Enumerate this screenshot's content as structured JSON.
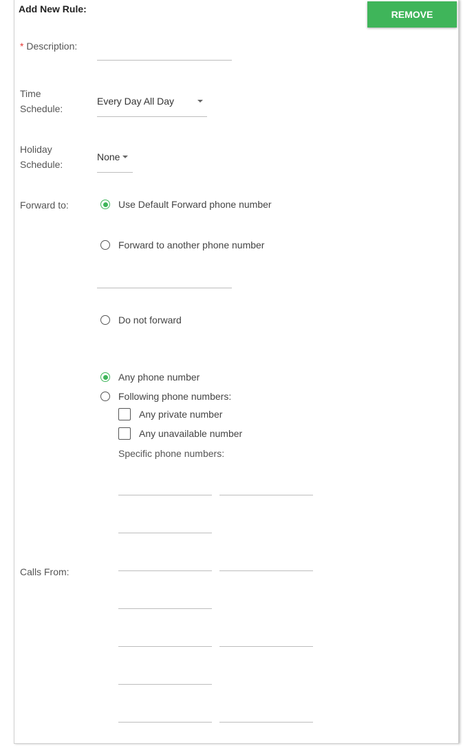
{
  "form": {
    "title": "Add New Rule:",
    "remove_label": "REMOVE",
    "required_mark": "*",
    "description_label": "Description:",
    "description_value": "",
    "time_schedule_label_line1": "Time",
    "time_schedule_label_line2": "Schedule:",
    "time_schedule_value": "Every Day All Day",
    "holiday_schedule_label_line1": "Holiday",
    "holiday_schedule_label_line2": "Schedule:",
    "holiday_schedule_value": "None",
    "forward_to_label": "Forward to:",
    "forward_options": [
      {
        "label": "Use Default Forward phone number",
        "checked": true
      },
      {
        "label": "Forward to another phone number",
        "checked": false
      },
      {
        "label": "Do not forward",
        "checked": false
      }
    ],
    "another_number_value": "",
    "calls_from_label": "Calls From:",
    "calls_from_options": [
      {
        "label": "Any phone number",
        "checked": true
      },
      {
        "label": "Following phone numbers:",
        "checked": false
      }
    ],
    "checkbox_options": [
      {
        "label": "Any private number",
        "checked": false
      },
      {
        "label": "Any unavailable number",
        "checked": false
      }
    ],
    "specific_label": "Specific phone numbers:"
  },
  "colors": {
    "accent": "#3fb55a",
    "required": "#e53935"
  }
}
